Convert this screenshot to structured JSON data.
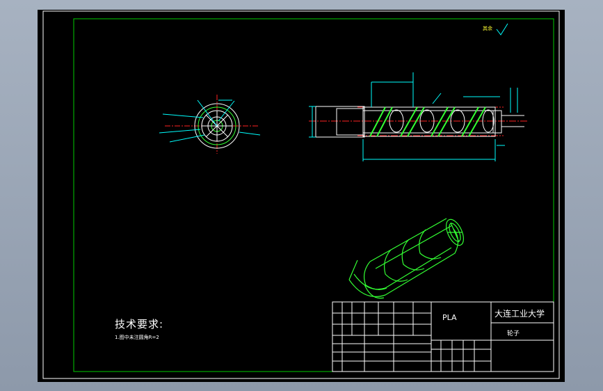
{
  "tech_requirements": {
    "title": "技术要求:",
    "note": "1.图中未注圆角R=2"
  },
  "title_block": {
    "material": "PLA",
    "school": "大连工业大学",
    "part_name": "轮子"
  },
  "roughness_label": "其余",
  "colors": {
    "background": "#000000",
    "frame": "#00cc00",
    "dimension": "#00ffff",
    "centerline": "#ff2222",
    "part_outline": "#ffffff",
    "iso_view": "#33ff33"
  }
}
